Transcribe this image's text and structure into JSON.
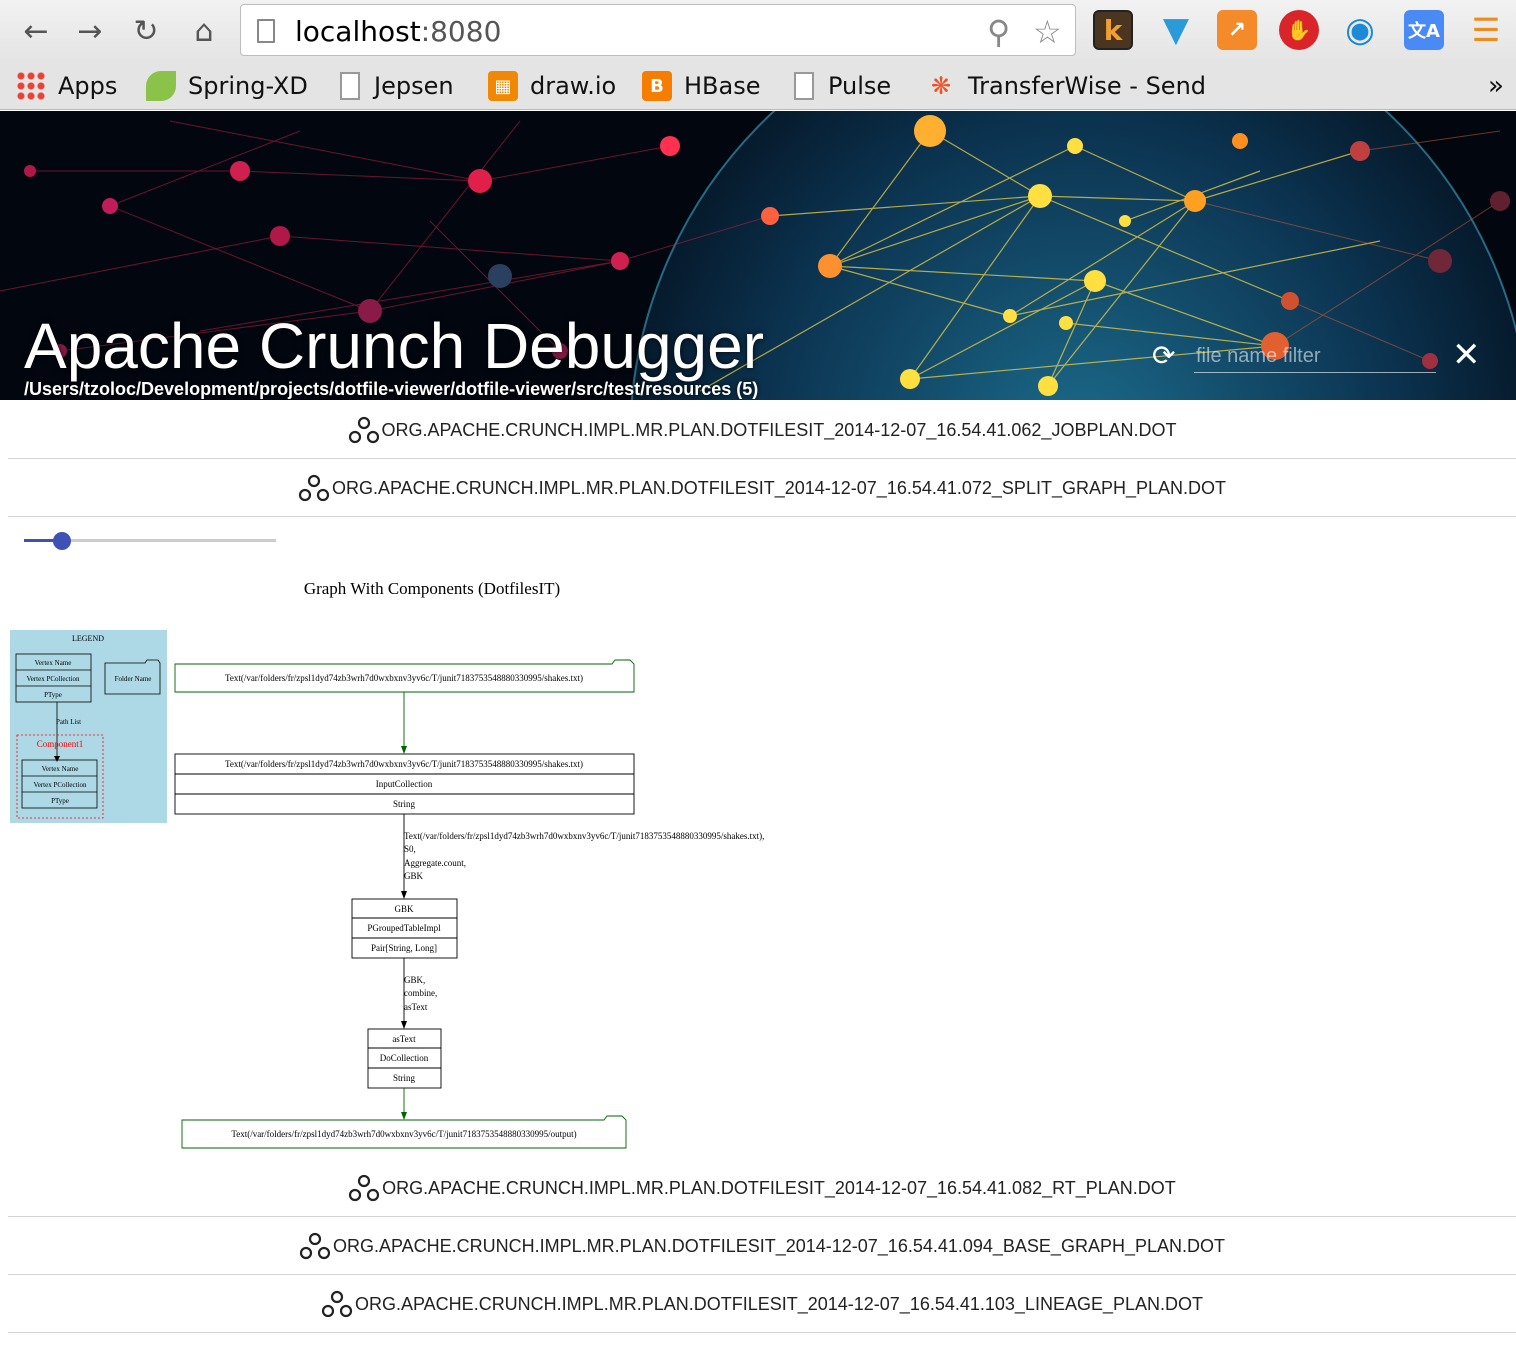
{
  "browser": {
    "address": {
      "host": "localhost",
      "port": ":8080"
    },
    "bookmarks": [
      {
        "label": "Apps",
        "icon": "apps-grid-icon"
      },
      {
        "label": "Spring-XD",
        "icon": "spring-leaf-icon"
      },
      {
        "label": "Jepsen",
        "icon": "page-icon"
      },
      {
        "label": "draw.io",
        "icon": "drawio-icon"
      },
      {
        "label": "HBase",
        "icon": "blogger-icon"
      },
      {
        "label": "Pulse",
        "icon": "page-icon"
      },
      {
        "label": "TransferWise - Send",
        "icon": "transferwise-icon"
      }
    ],
    "more_glyph": "»",
    "extensions": [
      "k",
      "filter",
      "chart",
      "stop",
      "eye",
      "translate"
    ]
  },
  "hero": {
    "title": "Apache Crunch Debugger",
    "path": "/Users/tzoloc/Development/projects/dotfile-viewer/dotfile-viewer/src/test/resources (5)",
    "filter_placeholder": "file name filter"
  },
  "files": [
    {
      "name": "ORG.APACHE.CRUNCH.IMPL.MR.PLAN.DOTFILESIT_2014-12-07_16.54.41.062_JOBPLAN.DOT"
    },
    {
      "name": "ORG.APACHE.CRUNCH.IMPL.MR.PLAN.DOTFILESIT_2014-12-07_16.54.41.072_SPLIT_GRAPH_PLAN.DOT"
    },
    {
      "name": "ORG.APACHE.CRUNCH.IMPL.MR.PLAN.DOTFILESIT_2014-12-07_16.54.41.082_RT_PLAN.DOT"
    },
    {
      "name": "ORG.APACHE.CRUNCH.IMPL.MR.PLAN.DOTFILESIT_2014-12-07_16.54.41.094_BASE_GRAPH_PLAN.DOT"
    },
    {
      "name": "ORG.APACHE.CRUNCH.IMPL.MR.PLAN.DOTFILESIT_2014-12-07_16.54.41.103_LINEAGE_PLAN.DOT"
    }
  ],
  "zoom_slider": {
    "value": 0.15
  },
  "graph": {
    "title": "Graph With Components (DotfilesIT)",
    "legend": {
      "title": "LEGEND",
      "vertex_rows": [
        "Vertex Name",
        "Vertex PCollection",
        "PType"
      ],
      "folder": "Folder Name",
      "edge_label": "Path List",
      "component": "Component1",
      "component_rows": [
        "Vertex Name",
        "Vertex PCollection",
        "PType"
      ]
    },
    "source_folder": "Text(/var/folders/fr/zpsl1dyd74zb3wrh7d0wxbxnv3yv6c/T/junit7183753548880330995/shakes.txt)",
    "input_node": [
      "Text(/var/folders/fr/zpsl1dyd74zb3wrh7d0wxbxnv3yv6c/T/junit7183753548880330995/shakes.txt)",
      "InputCollection",
      "String"
    ],
    "edge1": [
      "Text(/var/folders/fr/zpsl1dyd74zb3wrh7d0wxbxnv3yv6c/T/junit7183753548880330995/shakes.txt),",
      "S0,",
      "Aggregate.count,",
      "GBK"
    ],
    "gbk_node": [
      "GBK",
      "PGroupedTableImpl",
      "Pair[String, Long]"
    ],
    "edge2": [
      "GBK,",
      "combine,",
      "asText"
    ],
    "astext_node": [
      "asText",
      "DoCollection",
      "String"
    ],
    "output_folder": "Text(/var/folders/fr/zpsl1dyd74zb3wrh7d0wxbxnv3yv6c/T/junit7183753548880330995/output)"
  },
  "colors": {
    "accent": "#3f51b5",
    "legend_bg": "#add8e6",
    "edge_green": "#006400",
    "component_red": "#ff0000"
  }
}
